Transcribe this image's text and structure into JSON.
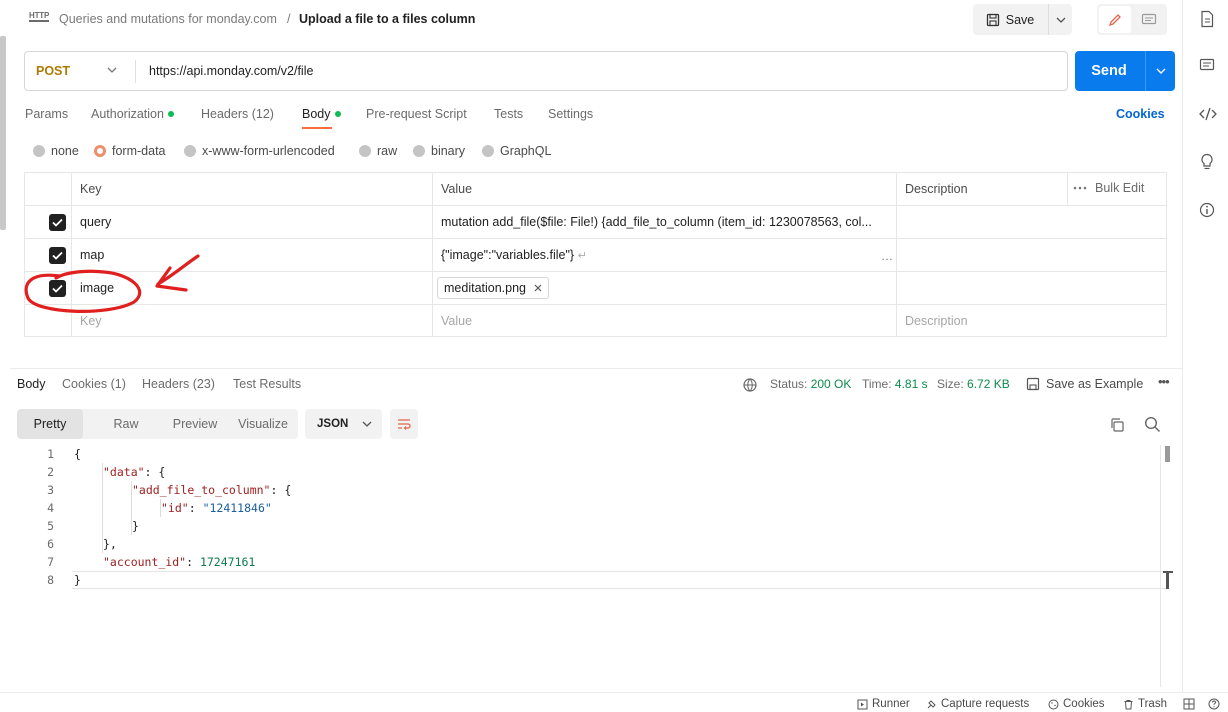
{
  "header": {
    "protocol_badge": "HTTP",
    "collection": "Queries and mutations for monday.com",
    "separator": "/",
    "request_name": "Upload a file to a files column",
    "save_label": "Save"
  },
  "request": {
    "method": "POST",
    "url": "https://api.monday.com/v2/file",
    "send_label": "Send"
  },
  "request_tabs": {
    "params": "Params",
    "authorization": "Authorization",
    "headers": "Headers (12)",
    "body": "Body",
    "pre_request": "Pre-request Script",
    "tests": "Tests",
    "settings": "Settings",
    "cookies": "Cookies"
  },
  "body_types": {
    "none": "none",
    "form_data": "form-data",
    "urlencoded": "x-www-form-urlencoded",
    "raw": "raw",
    "binary": "binary",
    "graphql": "GraphQL",
    "selected": "form-data"
  },
  "form_table": {
    "headers": {
      "key": "Key",
      "value": "Value",
      "description": "Description",
      "bulk_edit": "Bulk Edit"
    },
    "rows": [
      {
        "key": "query",
        "value": "mutation add_file($file: File!) {add_file_to_column (item_id: 1230078563, col...",
        "description": ""
      },
      {
        "key": "map",
        "value": "{\"image\":\"variables.file\"}",
        "description": ""
      },
      {
        "key": "image",
        "file": "meditation.png",
        "description": ""
      }
    ],
    "placeholder": {
      "key": "Key",
      "value": "Value",
      "description": "Description"
    }
  },
  "response": {
    "tabs": {
      "body": "Body",
      "cookies": "Cookies (1)",
      "headers": "Headers (23)",
      "test_results": "Test Results"
    },
    "status_label": "Status:",
    "status_value": "200 OK",
    "time_label": "Time:",
    "time_value": "4.81 s",
    "size_label": "Size:",
    "size_value": "6.72 KB",
    "save_example": "Save as Example",
    "views": {
      "pretty": "Pretty",
      "raw": "Raw",
      "preview": "Preview",
      "visualize": "Visualize"
    },
    "format": "JSON"
  },
  "code": {
    "line_numbers": [
      "1",
      "2",
      "3",
      "4",
      "5",
      "6",
      "7",
      "8"
    ],
    "open_brace": "{",
    "close_brace": "}",
    "data_key": "\"data\"",
    "add_file_key": "\"add_file_to_column\"",
    "id_key": "\"id\"",
    "id_value": "\"12411846\"",
    "account_key": "\"account_id\"",
    "account_value": "17247161"
  },
  "status_bar": {
    "runner": "Runner",
    "capture": "Capture requests",
    "cookies": "Cookies",
    "trash": "Trash"
  },
  "colors": {
    "accent": "#ff6c37",
    "send": "#097bed",
    "method": "#ad7a03",
    "annotation": "#e0201f"
  }
}
